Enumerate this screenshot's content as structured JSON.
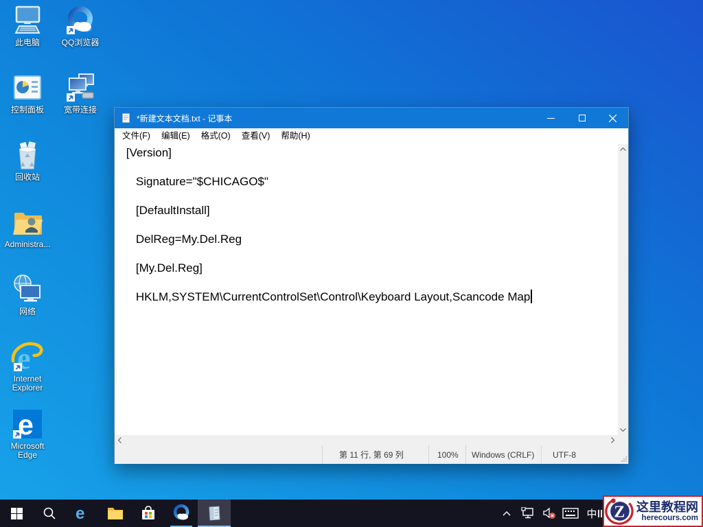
{
  "desktop": {
    "icons": {
      "this_pc": "此电脑",
      "qq_browser": "QQ浏览器",
      "control_panel": "控制面板",
      "broadband": "宽带连接",
      "recycle_bin": "回收站",
      "admin_folder": "Administra...",
      "network": "网络",
      "internet_explorer": "Internet Explorer",
      "microsoft_edge": "Microsoft Edge"
    }
  },
  "notepad": {
    "title": "*新建文本文档.txt - 记事本",
    "menu": [
      "文件(F)",
      "编辑(E)",
      "格式(O)",
      "查看(V)",
      "帮助(H)"
    ],
    "content": " [Version]\n\n    Signature=\"$CHICAGO$\"\n\n    [DefaultInstall]\n\n    DelReg=My.Del.Reg\n\n    [My.Del.Reg]\n\n    HKLM,SYSTEM\\CurrentControlSet\\Control\\Keyboard Layout,Scancode Map",
    "status": {
      "line_col": "第 11 行, 第 69 列",
      "zoom_level": "100%",
      "line_ending": "Windows (CRLF)",
      "encoding": "UTF-8"
    }
  },
  "taskbar": {
    "input_mode": "中"
  },
  "watermark": {
    "site_name": "这里教程网",
    "site_url": "herecours.com",
    "logo_letter": "Z"
  }
}
